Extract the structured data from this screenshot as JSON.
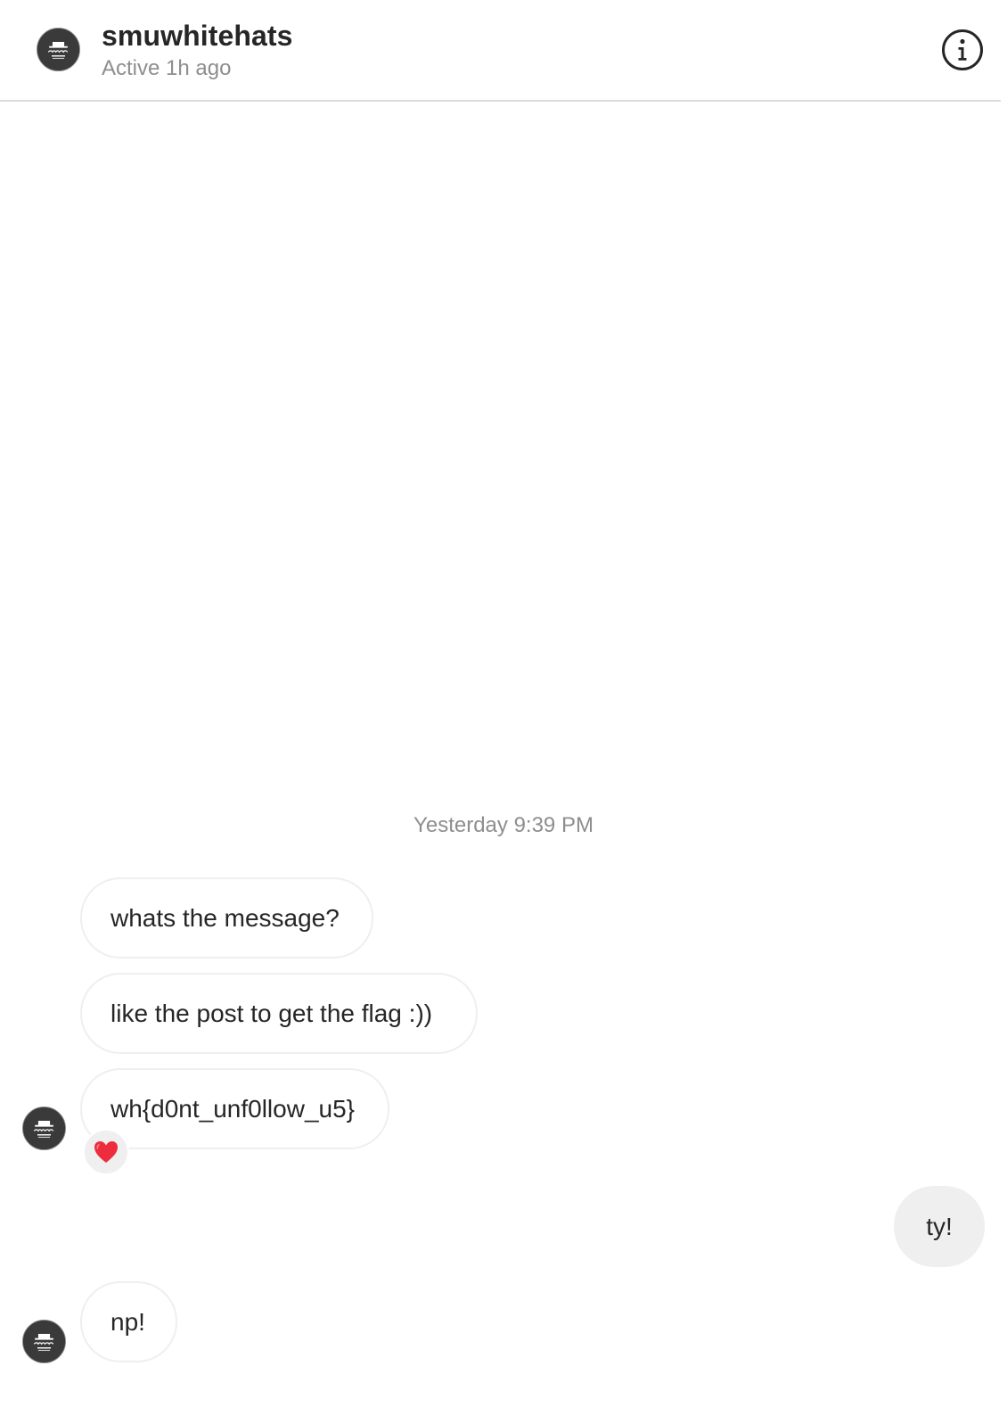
{
  "header": {
    "username": "smuwhitehats",
    "status": "Active 1h ago",
    "avatar_icon": "whitehat-society-logo",
    "info_icon": "info-circle-icon"
  },
  "thread": {
    "timestamp": "Yesterday 9:39 PM",
    "messages": [
      {
        "from": "them",
        "text": "whats the message?"
      },
      {
        "from": "them",
        "text": "like the post to get the flag :))"
      },
      {
        "from": "them",
        "text": "wh{d0nt_unf0llow_u5}",
        "reaction": "heart"
      },
      {
        "from": "me",
        "text": "ty!"
      },
      {
        "from": "them",
        "text": "np!"
      }
    ]
  },
  "colors": {
    "text": "#262626",
    "secondary_text": "#8e8e8e",
    "bubble_border": "#efefef",
    "outgoing_bubble": "#efefef",
    "divider": "#dbdbdb",
    "reaction_heart": "#ed2d3d",
    "avatar_bg": "#3a3a3a"
  }
}
